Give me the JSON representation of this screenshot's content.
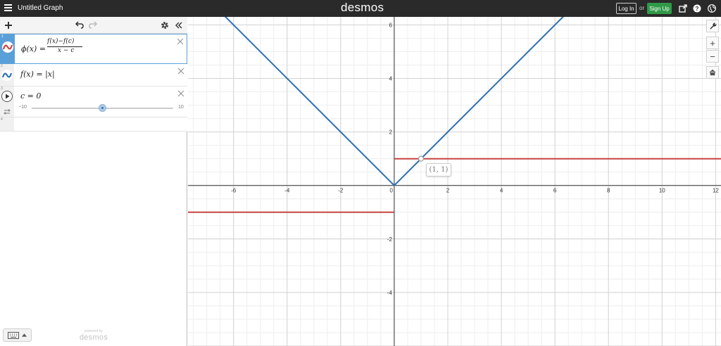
{
  "topbar": {
    "graph_title": "Untitled Graph",
    "brand": "desmos",
    "login_label": "Log In",
    "or_label": "or",
    "signup_label": "Sign Up",
    "icons": [
      "share-icon",
      "help-icon",
      "globe-icon"
    ],
    "signup_color": "#2f9a48"
  },
  "expressions": [
    {
      "number": "1",
      "latex": "\\phi(x) = \\frac{f(x) - f(c)}{x - c}",
      "lhs": "ϕ(x) =",
      "numerator": "f(x)−f(c)",
      "denominator": "x − c",
      "color": "#c74440",
      "selected": true
    },
    {
      "number": "2",
      "latex": "f(x) = |x|",
      "text": "f(x) = |x|",
      "color": "#2d70b3"
    },
    {
      "number": "3",
      "latex": "c = 0",
      "text": "c = 0",
      "slider": {
        "min_label": "−10",
        "max_label": "10",
        "value": 0,
        "min": -10,
        "max": 10
      }
    },
    {
      "number": "4"
    }
  ],
  "powered_by": {
    "small": "powered by",
    "logo": "desmos"
  },
  "zoom_controls": {
    "zoom_in": "+",
    "zoom_out": "−"
  },
  "graph": {
    "x_ticks": [
      "-6",
      "-4",
      "-2",
      "0",
      "2",
      "4",
      "6",
      "8",
      "10",
      "12"
    ],
    "y_ticks": [
      "6",
      "4",
      "2",
      "-2",
      "-4"
    ],
    "point_label": "(1, 1)"
  },
  "chart_data": {
    "type": "line",
    "xlim": [
      -7.7,
      12.2
    ],
    "ylim": [
      -6.0,
      6.3
    ],
    "grid": true,
    "series": [
      {
        "name": "f(x) = |x|",
        "color": "#2d70b3",
        "x": [
          -7.7,
          0,
          12.2
        ],
        "y": [
          7.7,
          0,
          12.2
        ]
      },
      {
        "name": "ϕ(x)",
        "color": "#c74440",
        "x": [
          -7.7,
          0
        ],
        "y": [
          -1,
          -1
        ]
      },
      {
        "name": "ϕ(x)",
        "color": "#c74440",
        "x": [
          0,
          12.2
        ],
        "y": [
          1,
          1
        ]
      }
    ],
    "points": [
      {
        "x": 1,
        "y": 1,
        "label": "(1, 1)"
      }
    ]
  }
}
